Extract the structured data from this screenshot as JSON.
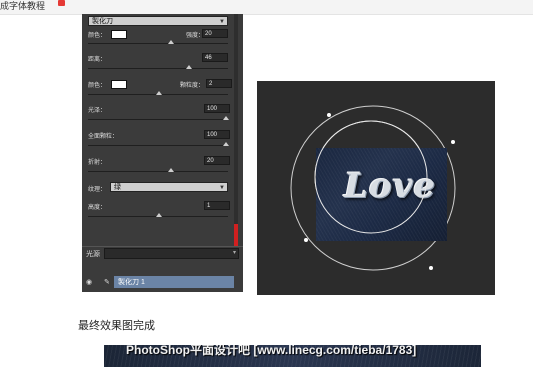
{
  "page": {
    "title_fragment": "成字体教程"
  },
  "panel": {
    "top_select": "製化刀",
    "rows": [
      {
        "label": "颜色：",
        "value_label": "强度：",
        "value": "20"
      },
      {
        "label": "距离：",
        "value": "46"
      },
      {
        "label": "颜色：",
        "value_label": "颗粒度：",
        "value": "2"
      },
      {
        "label": "光泽：",
        "value": "100"
      },
      {
        "label": "全面颗粒：",
        "value": "100"
      },
      {
        "label": "折射：",
        "value": "20"
      },
      {
        "label": "纹理：",
        "select": "绿"
      },
      {
        "label": "高度：",
        "value": "1"
      }
    ],
    "mask_label": "光源",
    "layer_name": "製化刀 1"
  },
  "canvas": {
    "image_text": "Love"
  },
  "caption": "最终效果图完成",
  "watermark": "PhotoShop平面设计吧 [www.linecg.com/tieba/1783]",
  "colors": {
    "panel_bg": "#3b3b3b",
    "layer_highlight": "#6b84a6",
    "scroll_marker": "#d02020",
    "canvas_bg": "#2c2c2c"
  }
}
